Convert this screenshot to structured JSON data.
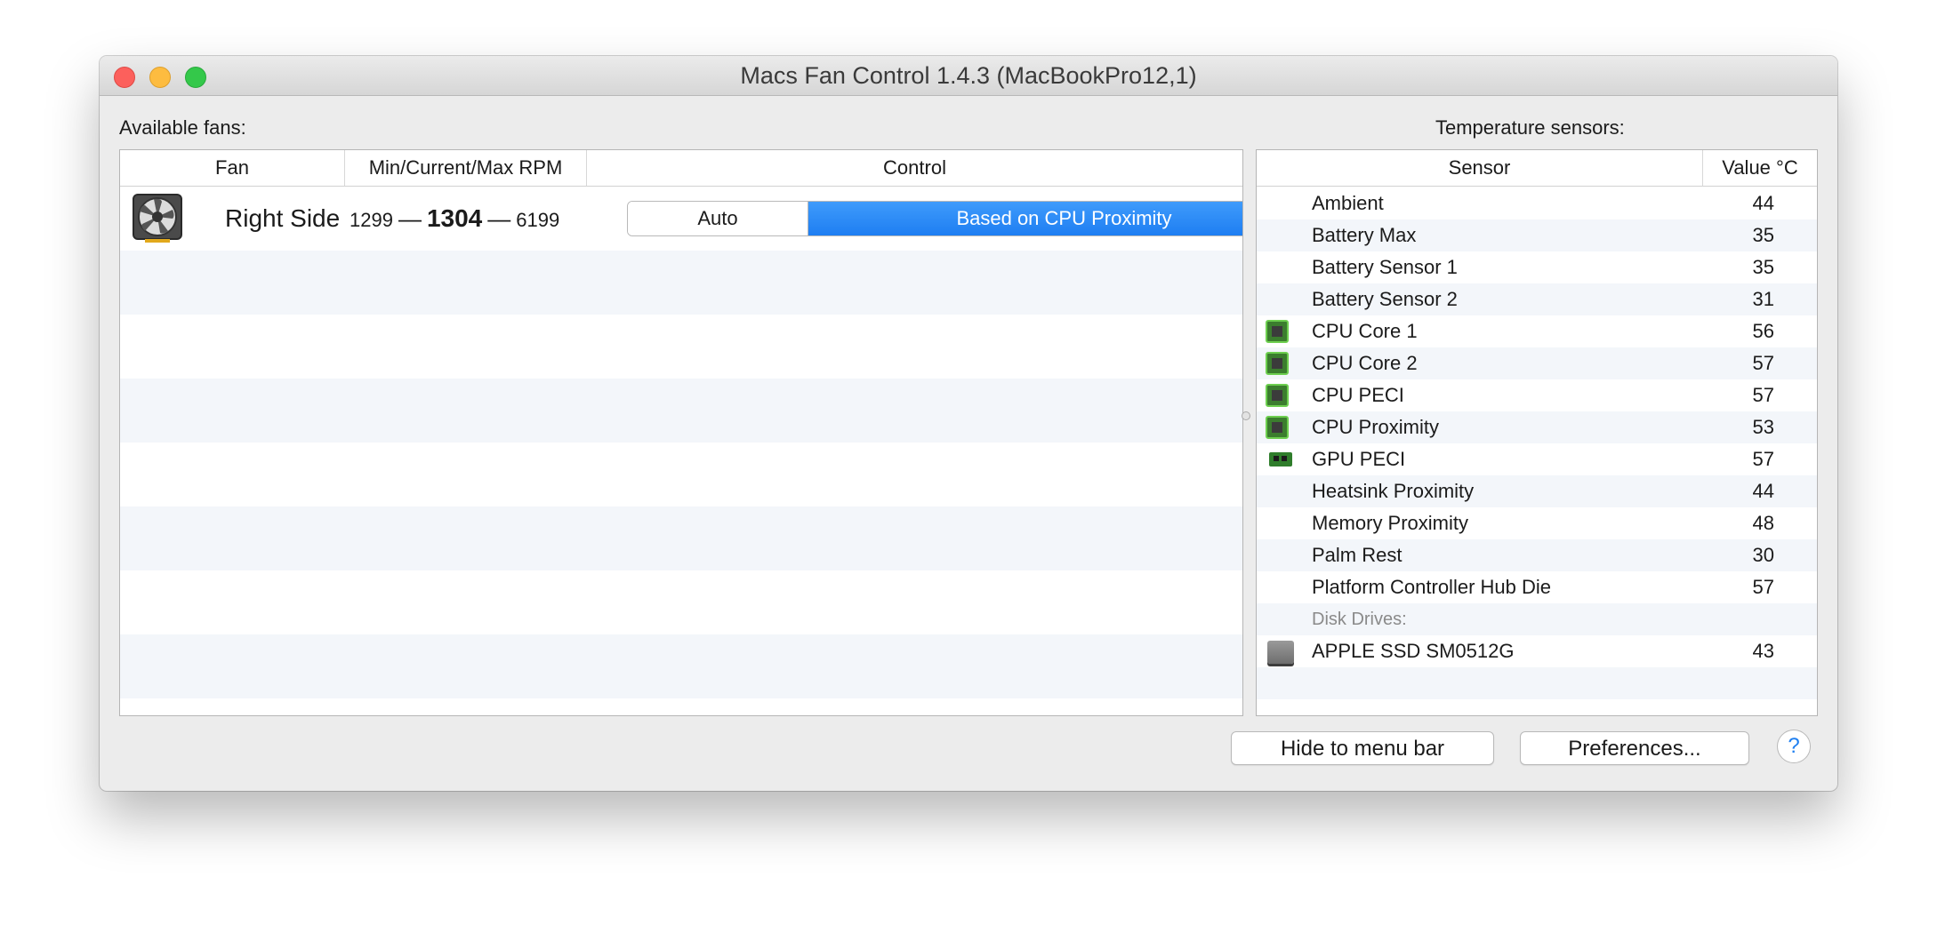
{
  "window": {
    "title": "Macs Fan Control 1.4.3 (MacBookPro12,1)"
  },
  "fans": {
    "section_label": "Available fans:",
    "columns": [
      "Fan",
      "Min/Current/Max RPM",
      "Control"
    ],
    "rows": [
      {
        "name": "Right Side",
        "min_rpm": "1299",
        "current_rpm": "1304",
        "max_rpm": "6199",
        "dash": "—",
        "control_options": [
          "Auto",
          "Based on CPU Proximity"
        ],
        "control_selected": "Based on CPU Proximity",
        "icon": "fan-icon"
      }
    ]
  },
  "sensors": {
    "section_label": "Temperature sensors:",
    "columns": [
      "Sensor",
      "Value °C"
    ],
    "rows": [
      {
        "name": "Ambient",
        "value": "44",
        "icon": ""
      },
      {
        "name": "Battery Max",
        "value": "35",
        "icon": ""
      },
      {
        "name": "Battery Sensor 1",
        "value": "35",
        "icon": ""
      },
      {
        "name": "Battery Sensor 2",
        "value": "31",
        "icon": ""
      },
      {
        "name": "CPU Core 1",
        "value": "56",
        "icon": "cpu-chip-icon"
      },
      {
        "name": "CPU Core 2",
        "value": "57",
        "icon": "cpu-chip-icon"
      },
      {
        "name": "CPU PECI",
        "value": "57",
        "icon": "cpu-chip-icon"
      },
      {
        "name": "CPU Proximity",
        "value": "53",
        "icon": "cpu-chip-icon"
      },
      {
        "name": "GPU PECI",
        "value": "57",
        "icon": "gpu-card-icon"
      },
      {
        "name": "Heatsink Proximity",
        "value": "44",
        "icon": ""
      },
      {
        "name": "Memory Proximity",
        "value": "48",
        "icon": ""
      },
      {
        "name": "Palm Rest",
        "value": "30",
        "icon": ""
      },
      {
        "name": "Platform Controller Hub Die",
        "value": "57",
        "icon": ""
      }
    ],
    "group_label": "Disk Drives:",
    "disk_rows": [
      {
        "name": "APPLE SSD SM0512G",
        "value": "43",
        "icon": "disk-drive-icon"
      }
    ]
  },
  "footer": {
    "hide_label": "Hide to menu bar",
    "preferences_label": "Preferences...",
    "help_label": "?"
  },
  "colors": {
    "accent": "#1e7ef2",
    "close": "#fc605c",
    "minimize": "#fdbc40",
    "maximize": "#34c84a"
  }
}
